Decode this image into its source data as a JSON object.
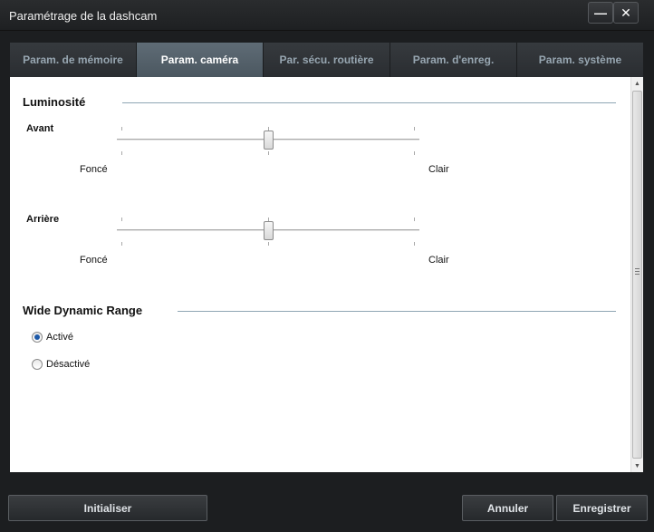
{
  "window": {
    "title": "Paramétrage de la dashcam",
    "minimize_label": "—",
    "close_label": "✕"
  },
  "tabs": [
    {
      "label": "Param. de mémoire",
      "active": false
    },
    {
      "label": "Param. caméra",
      "active": true
    },
    {
      "label": "Par. sécu. routière",
      "active": false
    },
    {
      "label": "Param. d'enreg.",
      "active": false
    },
    {
      "label": "Param. système",
      "active": false
    }
  ],
  "brightness": {
    "title": "Luminosité",
    "front": {
      "label": "Avant",
      "min_label": "Foncé",
      "max_label": "Clair",
      "level": 0.5
    },
    "rear": {
      "label": "Arrière",
      "min_label": "Foncé",
      "max_label": "Clair",
      "level": 0.5
    }
  },
  "wdr": {
    "title": "Wide Dynamic Range",
    "options": [
      {
        "label": "Activé",
        "selected": true
      },
      {
        "label": "Désactivé",
        "selected": false
      }
    ]
  },
  "footer": {
    "reset_label": "Initialiser",
    "cancel_label": "Annuler",
    "save_label": "Enregistrer"
  },
  "colors": {
    "active_tab": "#56626b",
    "tab_text": "#97a6b1",
    "radio_selected": "#1e5aa8",
    "section_line": "#8fa6b4"
  }
}
